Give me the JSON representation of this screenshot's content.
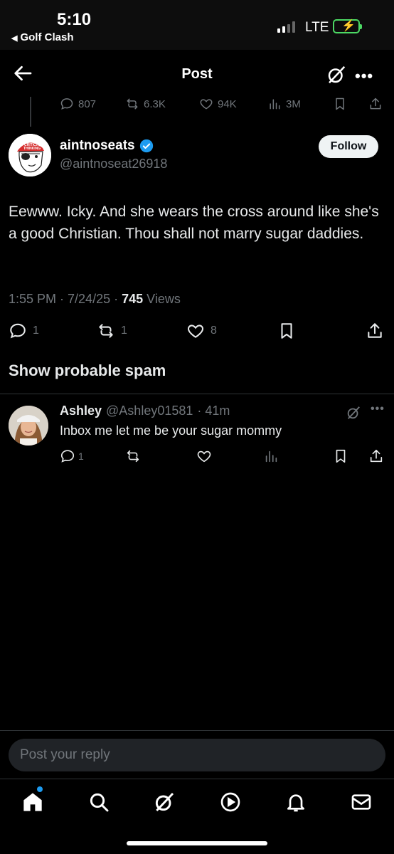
{
  "status_bar": {
    "time": "5:10",
    "back_app": "Golf Clash",
    "network": "LTE"
  },
  "header": {
    "title": "Post"
  },
  "previous_post_stats": {
    "replies": "807",
    "reposts": "6.3K",
    "likes": "94K",
    "views": "3M"
  },
  "main_post": {
    "display_name": "aintnoseats",
    "handle": "@aintnoseat26918",
    "follow_label": "Follow",
    "text": "Eewww. Icky. And she wears the cross around like she's a good Christian. Thou shall not marry sugar daddies.",
    "timestamp": "1:55 PM · 7/24/25 · ",
    "views_count": "745",
    "views_label": " Views",
    "replies": "1",
    "reposts": "1",
    "likes": "8"
  },
  "spam_section": {
    "label": "Show probable spam"
  },
  "reply": {
    "display_name": "Ashley",
    "handle": "@Ashley01581",
    "time": "· 41m",
    "text": "Inbox me let me be your sugar mommy",
    "replies": "1"
  },
  "composer": {
    "placeholder": "Post your reply"
  },
  "colors": {
    "background": "#000000",
    "text_primary": "#e7e9ea",
    "text_secondary": "#71767b",
    "accent": "#1d9bf0",
    "battery": "#4cd964"
  },
  "nav_icons": [
    "home-icon",
    "search-icon",
    "grok-icon",
    "video-icon",
    "notifications-icon",
    "messages-icon"
  ]
}
